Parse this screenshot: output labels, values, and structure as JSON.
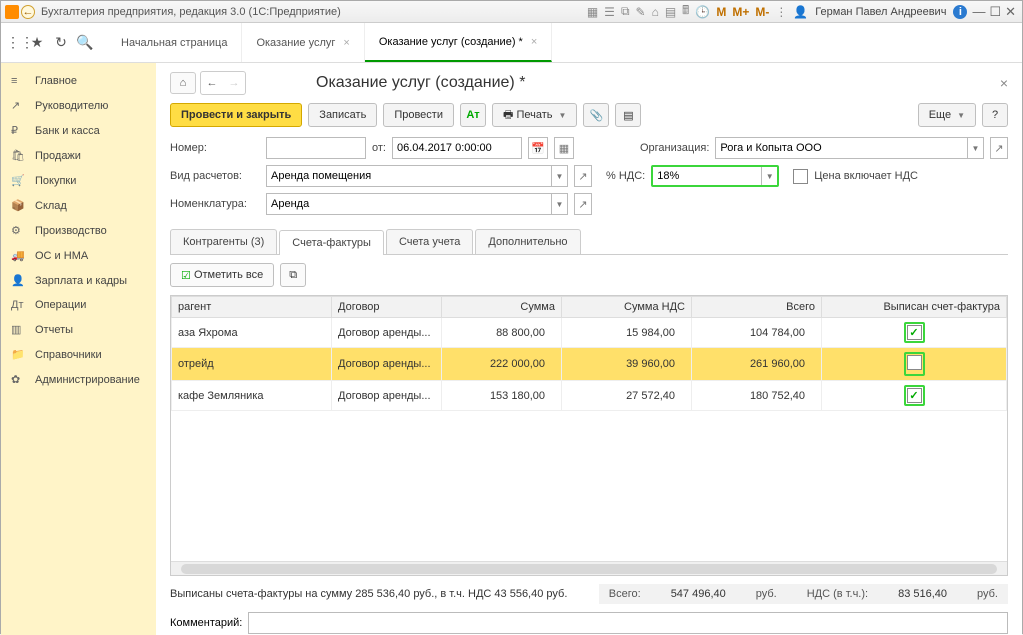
{
  "title_bar": {
    "app_title": "Бухгалтерия предприятия, редакция 3.0  (1С:Предприятие)",
    "m_minus": "M",
    "m_plus": "M+",
    "m_minus2": "M-",
    "user_name": "Герман Павел Андреевич"
  },
  "top_tabs": {
    "t1": "Начальная страница",
    "t2": "Оказание услуг",
    "t3": "Оказание услуг (создание) *"
  },
  "sidebar": {
    "items": [
      {
        "icon": "≡",
        "label": "Главное"
      },
      {
        "icon": "↗",
        "label": "Руководителю"
      },
      {
        "icon": "₽",
        "label": "Банк и касса"
      },
      {
        "icon": "🛍",
        "label": "Продажи"
      },
      {
        "icon": "🛒",
        "label": "Покупки"
      },
      {
        "icon": "📦",
        "label": "Склад"
      },
      {
        "icon": "⚙",
        "label": "Производство"
      },
      {
        "icon": "🚚",
        "label": "ОС и НМА"
      },
      {
        "icon": "👤",
        "label": "Зарплата и кадры"
      },
      {
        "icon": "Дт",
        "label": "Операции"
      },
      {
        "icon": "▥",
        "label": "Отчеты"
      },
      {
        "icon": "📁",
        "label": "Справочники"
      },
      {
        "icon": "✿",
        "label": "Администрирование"
      }
    ]
  },
  "form": {
    "title": "Оказание услуг (создание) *",
    "buttons": {
      "post_close": "Провести и закрыть",
      "save": "Записать",
      "post": "Провести",
      "print": "Печать",
      "more": "Еще",
      "help": "?"
    },
    "labels": {
      "number": "Номер:",
      "from": "от:",
      "org": "Организация:",
      "calc_type": "Вид расчетов:",
      "nds_pct": "% НДС:",
      "price_incl": "Цена включает НДС",
      "nomenclature": "Номенклатура:",
      "comment": "Комментарий:"
    },
    "values": {
      "number": "",
      "date": "06.04.2017  0:00:00",
      "org": "Рога и Копыта ООО",
      "calc_type": "Аренда помещения",
      "nds_pct": "18%",
      "nomenclature": "Аренда",
      "comment": ""
    },
    "subtabs": {
      "t1": "Контрагенты (3)",
      "t2": "Счета-фактуры",
      "t3": "Счета учета",
      "t4": "Дополнительно"
    },
    "subtoolbar": {
      "mark_all": "Отметить все"
    },
    "grid": {
      "headers": {
        "agent": "рагент",
        "contract": "Договор",
        "sum": "Сумма",
        "sum_nds": "Сумма НДС",
        "total": "Всего",
        "invoice": "Выписан счет-фактура"
      },
      "rows": [
        {
          "agent": "аза Яхрома",
          "contract": "Договор аренды...",
          "sum": "88 800,00",
          "sum_nds": "15 984,00",
          "total": "104 784,00",
          "checked": true
        },
        {
          "agent": "отрейд",
          "contract": "Договор аренды...",
          "sum": "222 000,00",
          "sum_nds": "39 960,00",
          "total": "261 960,00",
          "checked": false
        },
        {
          "agent": "кафе Земляника",
          "contract": "Договор аренды...",
          "sum": "153 180,00",
          "sum_nds": "27 572,40",
          "total": "180 752,40",
          "checked": true
        }
      ]
    },
    "footer": {
      "invoices_text": "Выписаны счета-фактуры на сумму 285 536,40 руб., в т.ч. НДС 43 556,40 руб.",
      "total_lbl": "Всего:",
      "total_val": "547 496,40",
      "rub": "руб.",
      "nds_lbl": "НДС (в т.ч.):",
      "nds_val": "83 516,40"
    }
  }
}
